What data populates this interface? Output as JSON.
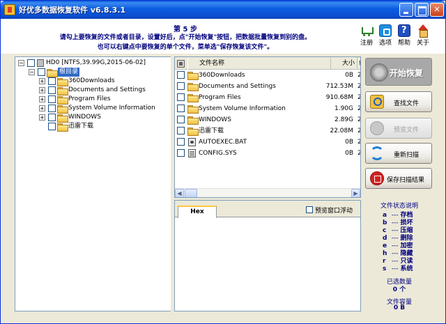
{
  "window": {
    "title": "好优多数据恢复软件  v6.8.3.1"
  },
  "header": {
    "step": "第 5 步",
    "instruction_line1": "请勾上要恢复的文件或者目录，设置好后，点\"开始恢复\"按钮，把数据批量恢复到别的盘。",
    "instruction_line2": "也可以右键点中要恢复的单个文件，菜单选\"保存恢复该文件\"。",
    "icons": [
      {
        "label": "注册",
        "icon": "cart-icon"
      },
      {
        "label": "选项",
        "icon": "options-icon"
      },
      {
        "label": "帮助",
        "icon": "help-icon"
      },
      {
        "label": "关于",
        "icon": "house-icon"
      }
    ]
  },
  "tree": {
    "drive": "HD0 [NTFS,39.99G,2015-06-02]",
    "root": "根目录",
    "children": [
      {
        "label": "360Downloads",
        "expandable": true
      },
      {
        "label": "Documents and Settings",
        "expandable": true
      },
      {
        "label": "Program Files",
        "expandable": true
      },
      {
        "label": "System Volume Information",
        "expandable": true
      },
      {
        "label": "WINDOWS",
        "expandable": true
      },
      {
        "label": "迅雷下载",
        "expandable": false
      }
    ]
  },
  "file_list": {
    "columns": {
      "name": "文件名称",
      "size": "大小",
      "attr": "创"
    },
    "rows": [
      {
        "name": "360Downloads",
        "size": "0B",
        "attr": "2",
        "type": "folder"
      },
      {
        "name": "Documents and Settings",
        "size": "712.53M",
        "attr": "2",
        "type": "folder"
      },
      {
        "name": "Program Files",
        "size": "910.68M",
        "attr": "2",
        "type": "folder"
      },
      {
        "name": "System Volume Information",
        "size": "1.90G",
        "attr": "2",
        "type": "folder"
      },
      {
        "name": "WINDOWS",
        "size": "2.89G",
        "attr": "2",
        "type": "folder"
      },
      {
        "name": "迅雷下载",
        "size": "22.08M",
        "attr": "2",
        "type": "folder"
      },
      {
        "name": "AUTOEXEC.BAT",
        "size": "0B",
        "attr": "2",
        "type": "bat"
      },
      {
        "name": "CONFIG.SYS",
        "size": "0B",
        "attr": "2",
        "type": "sys"
      }
    ]
  },
  "preview": {
    "tab": "Hex",
    "float_label": "预览窗口浮动"
  },
  "buttons": {
    "start": "开始恢复",
    "find": "查找文件",
    "preview": "预览文件",
    "rescan": "重新扫描",
    "save_scan": "保存扫描结果"
  },
  "status_legend": {
    "title": "文件状态说明",
    "items": [
      {
        "k": "a",
        "v": "存档"
      },
      {
        "k": "b",
        "v": "损坏"
      },
      {
        "k": "c",
        "v": "压缩"
      },
      {
        "k": "d",
        "v": "删除"
      },
      {
        "k": "e",
        "v": "加密"
      },
      {
        "k": "h",
        "v": "隐藏"
      },
      {
        "k": "r",
        "v": "只读"
      },
      {
        "k": "s",
        "v": "系统"
      }
    ],
    "separator": "---"
  },
  "selection": {
    "count_title": "已选数量",
    "count_value": "0 个",
    "capacity_title": "文件容量",
    "capacity_value": "0 B"
  },
  "colors": {
    "title_bar": "#0A4FD0",
    "instruction_text": "#000080",
    "selection": "#316AC5"
  }
}
